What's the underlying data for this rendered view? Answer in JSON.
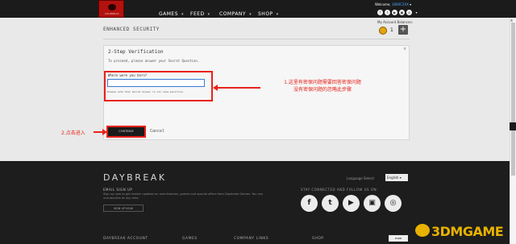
{
  "header": {
    "logo_text": "DAYBREAK",
    "nav": [
      {
        "label": "GAMES"
      },
      {
        "label": "FEED"
      },
      {
        "label": "COMPANY"
      },
      {
        "label": "SHOP"
      }
    ],
    "welcome_prefix": "Welcome,",
    "username": "1800C2XX",
    "social_icons": [
      "facebook-icon",
      "twitter-icon",
      "youtube-icon",
      "twitch-icon",
      "instagram-icon"
    ]
  },
  "balance": {
    "label": "My Account Balances:",
    "value": "1",
    "plus": "+"
  },
  "page": {
    "title": "ENHANCED SECURITY"
  },
  "panel": {
    "title": "2-Step Verification",
    "instruction": "To proceed, please answer your Secret Question.",
    "question_label": "Where were you born?",
    "answer_value": "",
    "note": "Please note that Secret Answer is not case-sensitive",
    "continue_label": "CONTINUE",
    "cancel_label": "Cancel",
    "close_label": "×"
  },
  "annotations": {
    "note1_line1": "1.这里有密保问题需要回答密保问题",
    "note1_line2": "没有密保问题的忽略此步骤",
    "note2": "2.点击进入"
  },
  "footer": {
    "logo": "DAYBREAK",
    "language_label": "Language Select:",
    "language_value": "English ▾",
    "email_title": "EMAIL SIGN UP",
    "email_desc": "Sign up now to get insider updates on new features, games and special offers from Daybreak Games. You can unsubscribe at any time.",
    "signup_label": "SIGN UP NOW",
    "stay_title": "STAY CONNECTED AND FOLLOW US ON:",
    "columns": [
      "DAYBREAK ACCOUNT",
      "GAMES",
      "COMPANY LINKS",
      "SHOP"
    ],
    "esrb": "ESRB",
    "watermark": "3DMGAME"
  },
  "colors": {
    "accent_red": "#e8221b",
    "logo_red": "#b3120f",
    "footer_bg": "#1d1d1d"
  }
}
